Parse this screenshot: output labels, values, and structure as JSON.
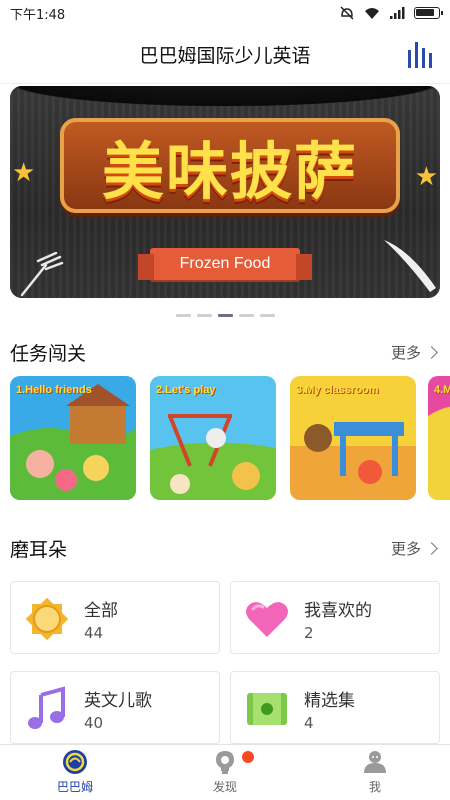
{
  "status": {
    "time": "下午1:48"
  },
  "header": {
    "title": "巴巴姆国际少儿英语",
    "menu_icon": "audio-bars-icon",
    "accent_color": "#2a4aa8"
  },
  "banner": {
    "title": "美味披萨",
    "subtitle": "Frozen Food",
    "page_count": 5,
    "active_page": 3
  },
  "tasks": {
    "title": "任务闯关",
    "more": "更多",
    "items": [
      {
        "label": "1.Hello friends"
      },
      {
        "label": "2.Let's play"
      },
      {
        "label": "3.My classroom"
      },
      {
        "label": "4.M"
      }
    ]
  },
  "ears": {
    "title": "磨耳朵",
    "more": "更多",
    "items": [
      {
        "name": "全部",
        "count": "44",
        "icon": "sun-icon"
      },
      {
        "name": "我喜欢的",
        "count": "2",
        "icon": "heart-icon"
      },
      {
        "name": "英文儿歌",
        "count": "40",
        "icon": "music-note-icon"
      },
      {
        "name": "精选集",
        "count": "4",
        "icon": "album-icon"
      }
    ]
  },
  "nav": {
    "items": [
      {
        "label": "巴巴姆",
        "icon": "babamu-logo-icon",
        "active": true
      },
      {
        "label": "发现",
        "icon": "bulb-icon",
        "active": false
      },
      {
        "label": "我",
        "icon": "user-icon",
        "active": false
      }
    ],
    "badge_color": "#f44a23"
  }
}
